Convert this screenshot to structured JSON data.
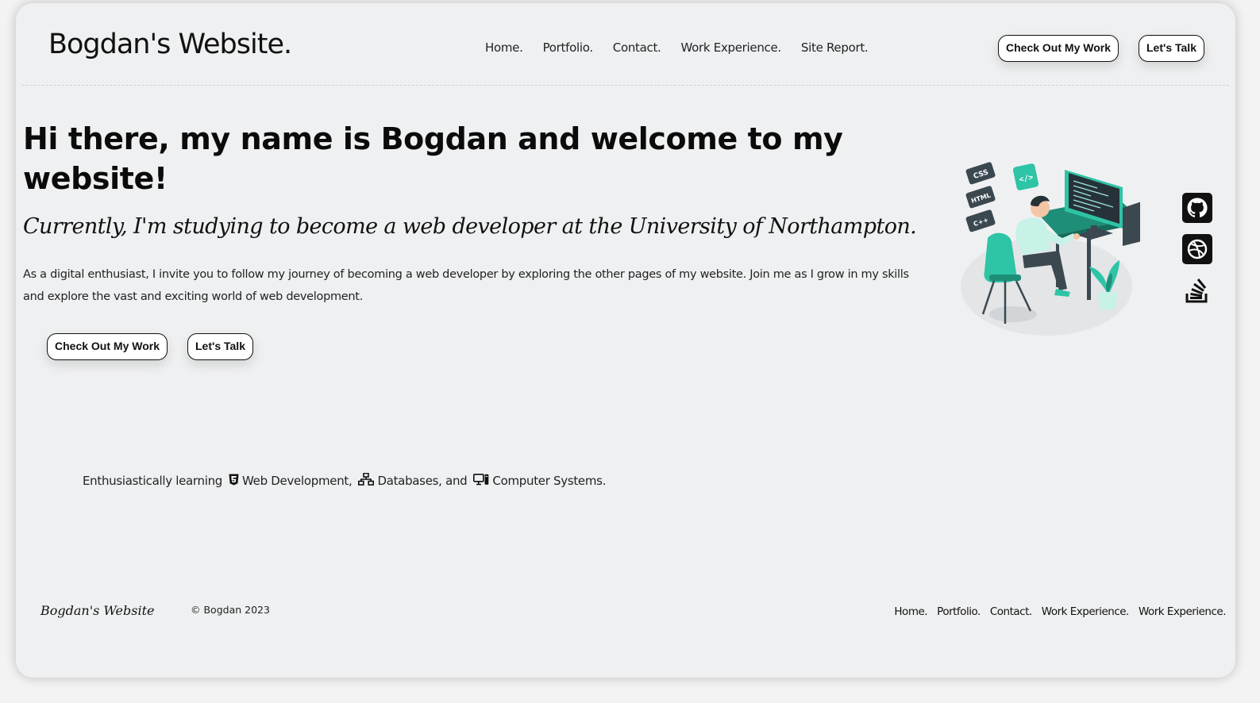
{
  "header": {
    "brand": "Bogdan's Website.",
    "nav": [
      "Home.",
      "Portfolio.",
      "Contact.",
      "Work Experience.",
      "Site Report."
    ],
    "cta_primary": "Check Out My Work",
    "cta_secondary": "Let's Talk"
  },
  "hero": {
    "heading": "Hi there, my name is Bogdan and welcome to my website!",
    "subtitle": "Currently, I'm studying to become a web developer at the University of Northampton.",
    "intro": "As a digital enthusiast, I invite you to follow my journey of becoming a web developer by exploring the other pages of my website. Join me as I grow in my skills and explore the vast and exciting world of web development.",
    "cta_primary": "Check Out My Work",
    "cta_secondary": "Let's Talk",
    "illustration_tags": [
      "CSS",
      "HTML",
      "C++"
    ]
  },
  "learning": {
    "prefix": "Enthusiastically learning",
    "items": [
      {
        "icon": "html5-icon",
        "label": "Web Development,"
      },
      {
        "icon": "sitemap-icon",
        "label": "Databases, and"
      },
      {
        "icon": "computer-icon",
        "label": "Computer Systems."
      }
    ]
  },
  "social": [
    "github-icon",
    "dribbble-icon",
    "stackoverflow-icon"
  ],
  "footer": {
    "brand": "Bogdan's Website",
    "copyright": "© Bogdan 2023",
    "nav": [
      "Home.",
      "Portfolio.",
      "Contact.",
      "Work Experience.",
      "Work Experience."
    ]
  },
  "colors": {
    "background": "#eff0f1",
    "accent_teal": "#2ec4a6",
    "text": "#111111"
  }
}
